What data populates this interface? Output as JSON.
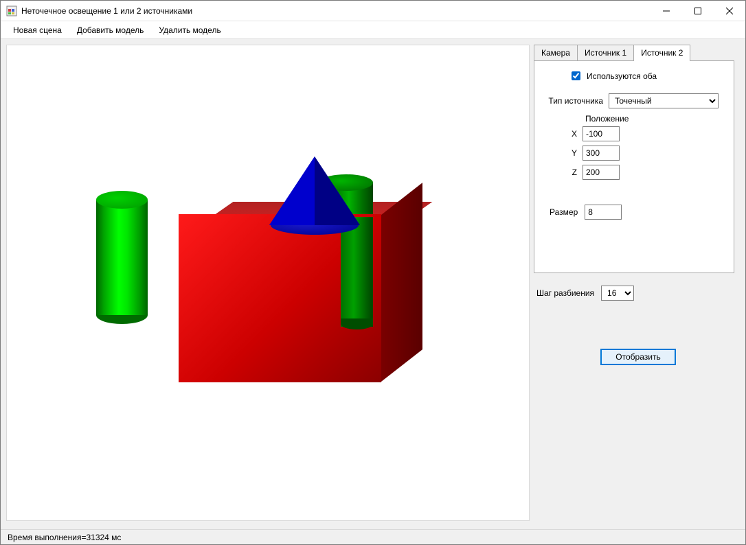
{
  "window": {
    "title": "Неточечное освещение 1 или 2 источниками"
  },
  "menu": {
    "new_scene": "Новая сцена",
    "add_model": "Добавить модель",
    "delete_model": "Удалить модель"
  },
  "tabs": {
    "camera": "Камера",
    "source1": "Источник 1",
    "source2": "Источник 2"
  },
  "panel": {
    "use_both_label": "Используются оба",
    "use_both_checked": true,
    "source_type_label": "Тип источника",
    "source_type_value": "Точечный",
    "source_type_options": [
      "Точечный"
    ],
    "position_label": "Положение",
    "x_label": "X",
    "y_label": "Y",
    "z_label": "Z",
    "x_value": "-100",
    "y_value": "300",
    "z_value": "200",
    "size_label": "Размер",
    "size_value": "8"
  },
  "step": {
    "label": "Шаг разбиения",
    "value": "16",
    "options": [
      "16"
    ]
  },
  "actions": {
    "render": "Отобразить"
  },
  "status": {
    "text": "Время выполнения=31324 мс"
  }
}
